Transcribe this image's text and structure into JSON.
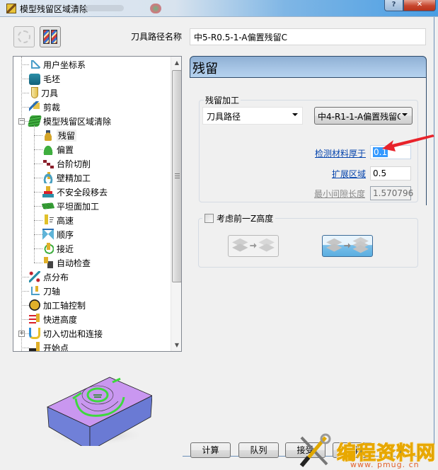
{
  "window": {
    "title": "模型残留区域清除",
    "help_label": "?",
    "close_label": "✕"
  },
  "toolbar": {
    "toolpath_name_label": "刀具路径名称",
    "toolpath_name_value": "中5-R0.5-1-A偏置残留C"
  },
  "tree": {
    "items": [
      {
        "label": "用户坐标系",
        "icon": "ucs-icon",
        "level": 0
      },
      {
        "label": "毛坯",
        "icon": "block-icon",
        "level": 0
      },
      {
        "label": "刀具",
        "icon": "tool-icon",
        "level": 0
      },
      {
        "label": "剪裁",
        "icon": "trim-icon",
        "level": 0
      },
      {
        "label": "模型残留区域清除",
        "icon": "layers-icon",
        "level": 0,
        "expanded": true
      },
      {
        "label": "残留",
        "icon": "rest-icon",
        "level": 1,
        "selected": true
      },
      {
        "label": "偏置",
        "icon": "offset-icon",
        "level": 1
      },
      {
        "label": "台阶切削",
        "icon": "step-cut-icon",
        "level": 1
      },
      {
        "label": "壁精加工",
        "icon": "wall-finish-icon",
        "level": 1
      },
      {
        "label": "不安全段移去",
        "icon": "unsafe-segment-icon",
        "level": 1
      },
      {
        "label": "平坦面加工",
        "icon": "flat-machining-icon",
        "level": 1
      },
      {
        "label": "高速",
        "icon": "high-speed-icon",
        "level": 1
      },
      {
        "label": "顺序",
        "icon": "order-icon",
        "level": 1
      },
      {
        "label": "接近",
        "icon": "approach-icon",
        "level": 1
      },
      {
        "label": "自动检查",
        "icon": "auto-check-icon",
        "level": 1
      },
      {
        "label": "点分布",
        "icon": "point-distribution-icon",
        "level": 0
      },
      {
        "label": "刀轴",
        "icon": "tool-axis-icon",
        "level": 0
      },
      {
        "label": "加工轴控制",
        "icon": "axis-control-icon",
        "level": 0
      },
      {
        "label": "快进高度",
        "icon": "rapid-height-icon",
        "level": 0
      },
      {
        "label": "切入切出和连接",
        "icon": "leads-links-icon",
        "level": 0,
        "collapsed": true
      },
      {
        "label": "开始点",
        "icon": "start-point-icon",
        "level": 0
      }
    ]
  },
  "panel": {
    "title": "残留",
    "rest_group": {
      "legend": "残留加工",
      "source_type": "刀具路径",
      "source_ref": "中4-R1-1-A偏置残留C",
      "detect_thicker_label": "检测材料厚于",
      "detect_thicker_value": "0.1",
      "expand_area_label": "扩展区域",
      "expand_area_value": "0.5",
      "min_gap_label": "最小间隙长度",
      "min_gap_value": "1.570796"
    },
    "z_group": {
      "checkbox_label": "考虑前一Z高度",
      "checked": false,
      "selected_option": 2
    }
  },
  "buttons": {
    "calculate": "计算",
    "queue": "队列",
    "accept": "接受",
    "cancel": "取消"
  },
  "watermark": {
    "text": "编程资料网",
    "url": "www. pmug. cn"
  },
  "colors": {
    "header_bg": "#a8c6e6",
    "link": "#0645ad",
    "selection": "#3399ff",
    "annotation_arrow": "#e8232b"
  }
}
